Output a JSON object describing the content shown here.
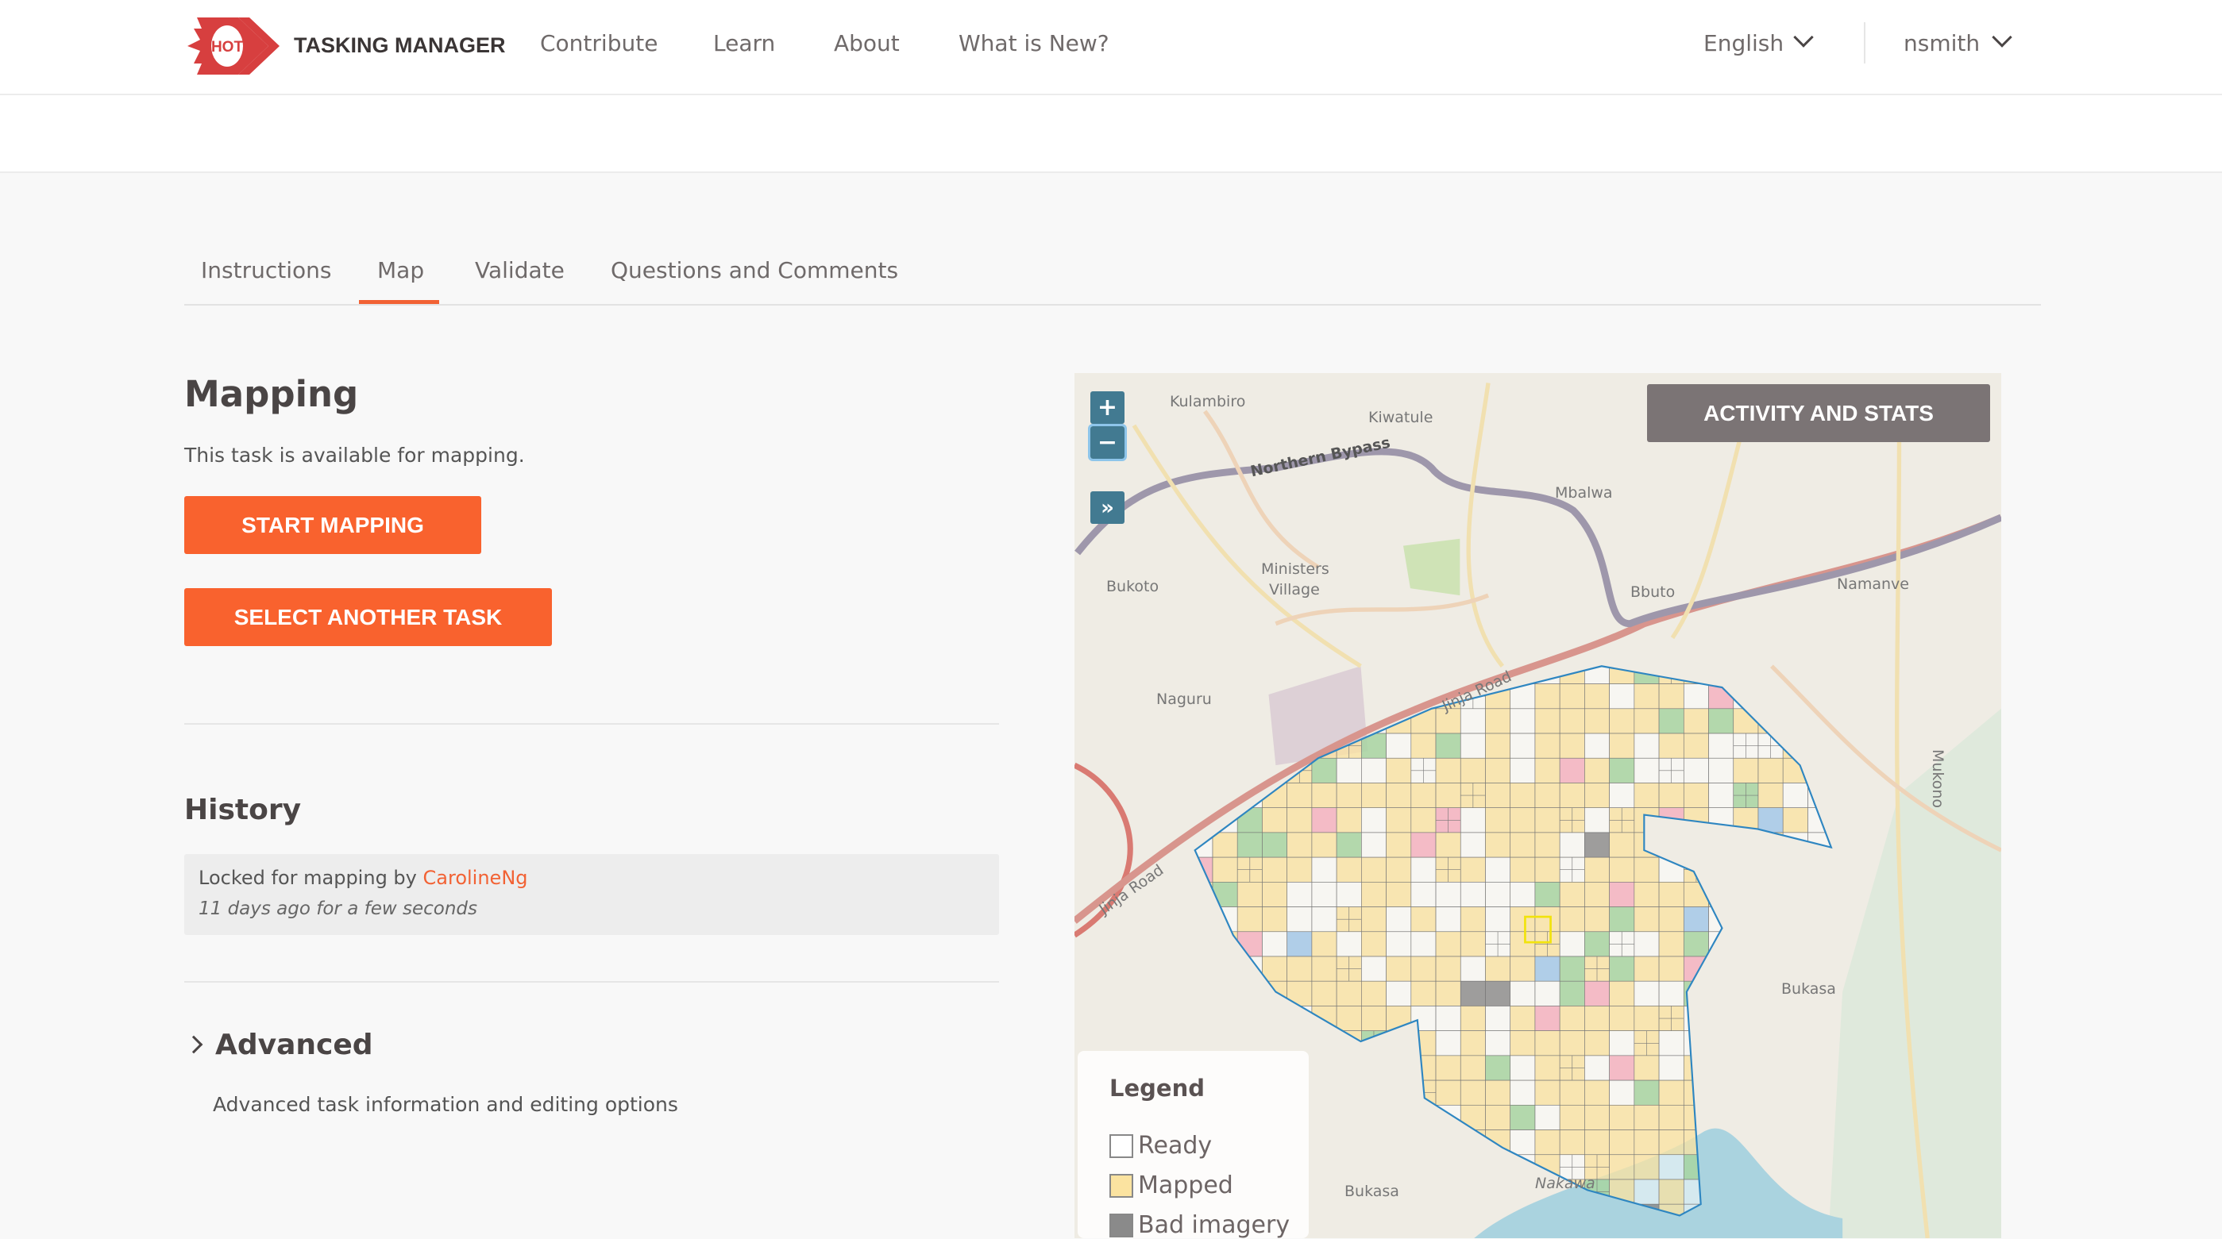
{
  "header": {
    "logo_text": "HOT",
    "brand": "TASKING MANAGER",
    "nav": [
      "Contribute",
      "Learn",
      "About",
      "What is New?"
    ],
    "language": "English",
    "user": "nsmith"
  },
  "tabs": [
    "Instructions",
    "Map",
    "Validate",
    "Questions and Comments"
  ],
  "active_tab": "Map",
  "mapping": {
    "title": "Mapping",
    "status": "This task is available for mapping.",
    "start_button": "START MAPPING",
    "select_button": "SELECT ANOTHER TASK"
  },
  "history": {
    "title": "History",
    "entry_prefix": "Locked for mapping by",
    "entry_user": "CarolineNg",
    "entry_time": "11 days ago for a few seconds"
  },
  "advanced": {
    "title": "Advanced",
    "description": "Advanced task information and editing options"
  },
  "map": {
    "activity_button": "ACTIVITY AND STATS",
    "zoom_in": "+",
    "zoom_out": "−",
    "expand": "»",
    "labels": [
      "Kulambiro",
      "Kiwatule",
      "Northern Bypass",
      "Mbalwa",
      "Ministers",
      "Village",
      "Bukoto",
      "Bbuto",
      "Namanve",
      "Naguru",
      "Jinja Road",
      "Bukasa",
      "Nakawa",
      "Mukono",
      "Bukasa",
      "Jinja Road"
    ],
    "legend": {
      "title": "Legend",
      "items": [
        {
          "label": "Ready",
          "color": "#ffffff"
        },
        {
          "label": "Mapped",
          "color": "#fbe3a0"
        },
        {
          "label": "Bad imagery",
          "color": "#8a8a8a"
        }
      ]
    }
  },
  "colors": {
    "accent": "#f9622e",
    "link": "#f26234",
    "grid_border": "#2e86c1",
    "validated": "#a8d5a2",
    "invalidated": "#f4b6c2",
    "locked": "#a9cbe8"
  }
}
